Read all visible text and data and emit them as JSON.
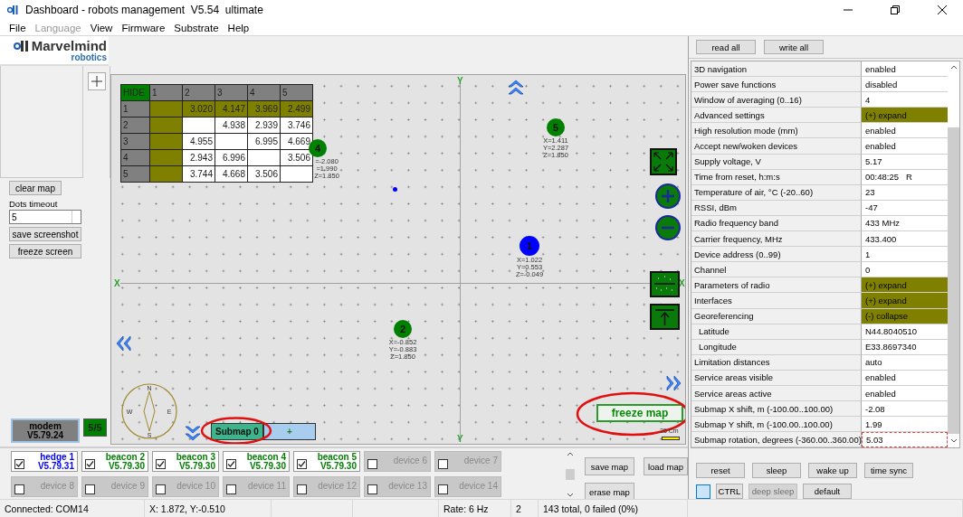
{
  "window": {
    "title": "Dashboard - robots management  V5.54  ultimate"
  },
  "menu": [
    {
      "label": "File",
      "disabled": false
    },
    {
      "label": "Language",
      "disabled": true
    },
    {
      "label": "View",
      "disabled": false
    },
    {
      "label": "Firmware",
      "disabled": false
    },
    {
      "label": "Substrate",
      "disabled": false
    },
    {
      "label": "Help",
      "disabled": false
    }
  ],
  "logo": {
    "name": "Marvelmind",
    "sub": "robotics"
  },
  "sidebar": {
    "clear_map": "clear map",
    "dots_label": "Dots timeout",
    "dots_value": "5",
    "buttons": [
      "save screenshot",
      "freeze screen"
    ]
  },
  "modem": {
    "label": "modem",
    "version": "V5.79.24",
    "count": "5/5"
  },
  "distance_table": {
    "hide": "HIDE",
    "columns": [
      {
        "label": "1",
        "highlighted": true
      },
      {
        "label": "2",
        "highlighted": false
      },
      {
        "label": "3",
        "highlighted": false
      },
      {
        "label": "4",
        "highlighted": false
      },
      {
        "label": "5",
        "highlighted": false
      }
    ],
    "rows": [
      {
        "label": "1",
        "highlighted": true,
        "cells": [
          null,
          "3.020",
          "4.147",
          "3.969",
          "2.499"
        ]
      },
      {
        "label": "2",
        "highlighted": false,
        "cells": [
          null,
          null,
          "4.938",
          "2.939",
          "3.746"
        ]
      },
      {
        "label": "3",
        "highlighted": false,
        "cells": [
          null,
          "4.955",
          null,
          "6.995",
          "4.669"
        ]
      },
      {
        "label": "4",
        "highlighted": false,
        "cells": [
          null,
          "2.943",
          "6.996",
          null,
          "3.506"
        ]
      },
      {
        "label": "5",
        "highlighted": false,
        "cells": [
          null,
          "3.744",
          "4.668",
          "3.506",
          null
        ]
      }
    ]
  },
  "map": {
    "axes": {
      "y_top": "Y",
      "x_left": "X",
      "x_right": "X",
      "y_bottom": "Y"
    },
    "beacons": [
      {
        "label": "5",
        "color": "#008000",
        "coords": [
          "X=1.411",
          "Y=2.287",
          "Z=1.850"
        ]
      },
      {
        "label": "4",
        "color": "#008000",
        "coords": [
          "=-2.080",
          "=1.990",
          "Z=1.850"
        ]
      },
      {
        "label": "1",
        "color": "#0000ff",
        "coords": [
          "X=1.022",
          "Y=0.553",
          "Z=-0.049"
        ]
      },
      {
        "label": "2",
        "color": "#008000",
        "coords": [
          "X=-0.852",
          "Y=-0.883",
          "Z=1.850"
        ]
      }
    ],
    "freeze_map": "freeze map",
    "compass": [
      "N",
      "W",
      "E",
      "S"
    ],
    "submaps": [
      {
        "label": "Submap 0",
        "selected": true
      },
      {
        "label": "+",
        "selected": false
      }
    ],
    "scale": "25 Cm"
  },
  "devices": [
    {
      "kind": "hedge",
      "name": "hedge 1",
      "version": "V5.79.31",
      "checked": true
    },
    {
      "kind": "beacon",
      "name": "beacon 2",
      "version": "V5.79.30",
      "checked": true
    },
    {
      "kind": "beacon",
      "name": "beacon 3",
      "version": "V5.79.30",
      "checked": true
    },
    {
      "kind": "beacon",
      "name": "beacon 4",
      "version": "V5.79.30",
      "checked": true
    },
    {
      "kind": "beacon",
      "name": "beacon 5",
      "version": "V5.79.30",
      "checked": true
    },
    {
      "kind": "empty",
      "name": "device 6",
      "checked": false
    },
    {
      "kind": "empty",
      "name": "device 7",
      "checked": false
    },
    {
      "kind": "empty",
      "name": "device 8",
      "checked": false
    },
    {
      "kind": "empty",
      "name": "device 9",
      "checked": false
    },
    {
      "kind": "empty",
      "name": "device 10",
      "checked": false
    },
    {
      "kind": "empty",
      "name": "device 11",
      "checked": false
    },
    {
      "kind": "empty",
      "name": "device 12",
      "checked": false
    },
    {
      "kind": "empty",
      "name": "device 13",
      "checked": false
    },
    {
      "kind": "empty",
      "name": "device 14",
      "checked": false
    }
  ],
  "map_buttons": [
    "save map",
    "load map",
    "erase map"
  ],
  "settings_buttons": [
    "read all",
    "write all"
  ],
  "settings": [
    {
      "label": "3D navigation",
      "value": "enabled",
      "kind": "value",
      "focused": false
    },
    {
      "label": "Power save functions",
      "value": "disabled",
      "kind": "value",
      "focused": false
    },
    {
      "label": "Window of averaging (0..16)",
      "value": "4",
      "kind": "value",
      "focused": false
    },
    {
      "label": "Advanced settings",
      "value": "(+) expand",
      "kind": "toggle",
      "focused": false
    },
    {
      "label": "High resolution mode (mm)",
      "value": "enabled",
      "kind": "value",
      "focused": false
    },
    {
      "label": "Accept new/woken devices",
      "value": "enabled",
      "kind": "value",
      "focused": false
    },
    {
      "label": "Supply voltage, V",
      "value": "5.17",
      "kind": "value",
      "focused": false
    },
    {
      "label": "Time from reset, h:m:s",
      "value": "00:48:25   R",
      "kind": "value",
      "focused": false
    },
    {
      "label": "Temperature of air, °C (-20..60)",
      "value": "23",
      "kind": "value",
      "focused": false
    },
    {
      "label": "RSSI, dBm",
      "value": "-47",
      "kind": "value",
      "focused": false
    },
    {
      "label": "Radio frequency band",
      "value": "433 MHz",
      "kind": "value",
      "focused": false
    },
    {
      "label": "Carrier frequency, MHz",
      "value": "433.400",
      "kind": "value",
      "focused": false
    },
    {
      "label": "Device address (0..99)",
      "value": "1",
      "kind": "value",
      "focused": false
    },
    {
      "label": "Channel",
      "value": "0",
      "kind": "value",
      "focused": false
    },
    {
      "label": "Parameters of radio",
      "value": "(+) expand",
      "kind": "toggle",
      "focused": false
    },
    {
      "label": "Interfaces",
      "value": "(+) expand",
      "kind": "toggle",
      "focused": false
    },
    {
      "label": "Georeferencing",
      "value": "(-) collapse",
      "kind": "toggle",
      "focused": false,
      "children": [
        {
          "label": "Latitude",
          "value": "N44.8040510",
          "focused": false
        },
        {
          "label": "Longitude",
          "value": "E33.8697340",
          "focused": false
        }
      ]
    },
    {
      "label": "Limitation distances",
      "value": "auto",
      "kind": "value",
      "focused": false
    },
    {
      "label": "Service areas visible",
      "value": "enabled",
      "kind": "value",
      "focused": false
    },
    {
      "label": "Service areas active",
      "value": "enabled",
      "kind": "value",
      "focused": false
    },
    {
      "label": "Submap X shift, m (-100.00..100.00)",
      "value": "-2.08",
      "kind": "value",
      "focused": false
    },
    {
      "label": "Submap Y shift, m (-100.00..100.00)",
      "value": "1.99",
      "kind": "value",
      "focused": false
    },
    {
      "label": "Submap rotation, degrees (-360.00..360.00)",
      "value": "5.03",
      "kind": "value",
      "focused": true
    }
  ],
  "actions": [
    {
      "label": "reset",
      "disabled": false
    },
    {
      "label": "sleep",
      "disabled": false
    },
    {
      "label": "wake up",
      "disabled": false
    },
    {
      "label": "time sync",
      "disabled": false
    }
  ],
  "actions2": [
    {
      "label": "CTRL",
      "disabled": false
    },
    {
      "label": "deep sleep",
      "disabled": true
    },
    {
      "label": "default",
      "disabled": false
    }
  ],
  "status_bar": [
    "Connected: COM14",
    "X: 1.872, Y:-0.510",
    "Rate: 6 Hz",
    "2",
    "143 total, 0 failed (0%)"
  ]
}
